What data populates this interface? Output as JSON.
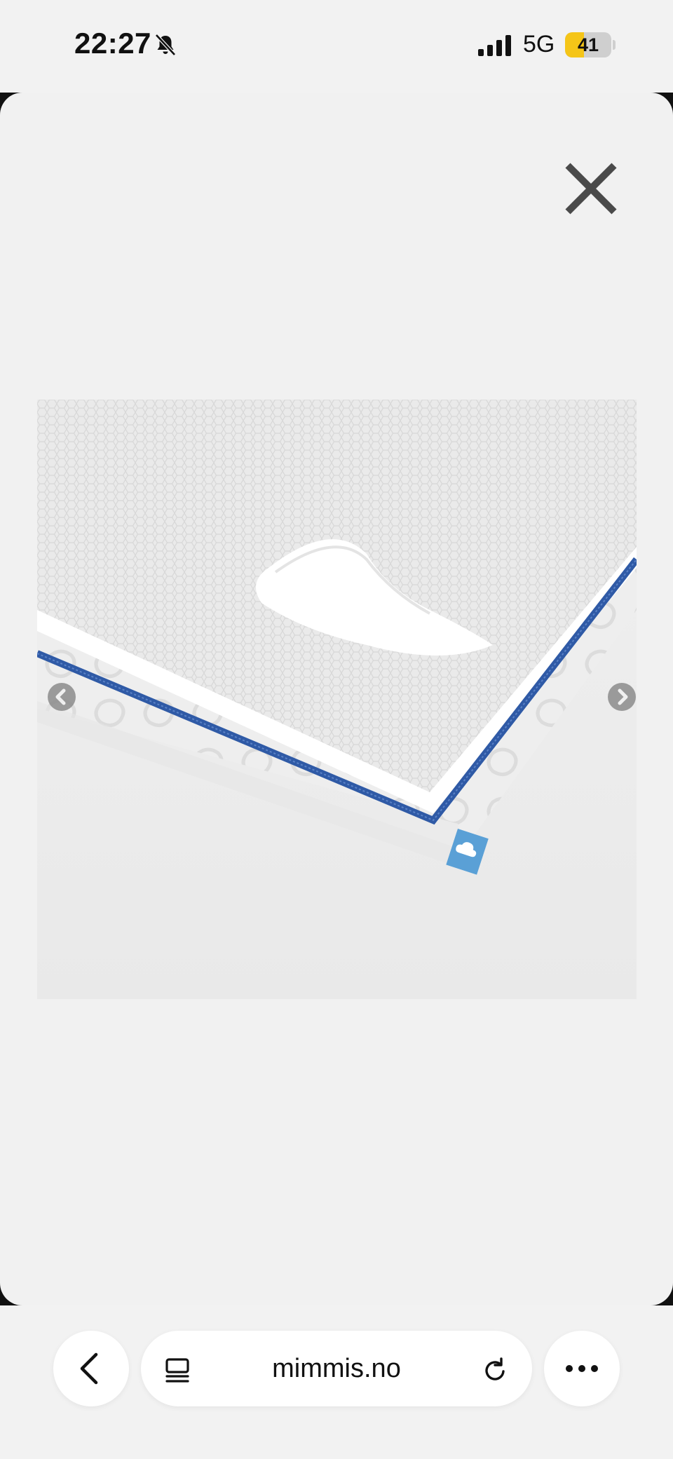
{
  "status_bar": {
    "time": "22:27",
    "network": "5G",
    "battery_level": "41",
    "battery_fraction": 0.41,
    "battery_color": "#f5c518",
    "icons": [
      "bell-slash-icon",
      "cellular-signal-icon",
      "battery-charging-icon"
    ]
  },
  "viewer": {
    "close_icon": "close-icon",
    "prev_icon": "chevron-left-icon",
    "next_icon": "chevron-right-icon",
    "image_alt": "Mattress with mesh cover, blue zipper and cloud tag"
  },
  "browser": {
    "url": "mimmis.no",
    "back_icon": "chevron-left-icon",
    "tabs_icon": "tabs-icon",
    "reload_icon": "reload-icon",
    "more_icon": "more-icon"
  },
  "colors": {
    "zipper_blue": "#2f5aa6",
    "tag_blue": "#5aa0d6",
    "background": "#f1f1f1"
  }
}
